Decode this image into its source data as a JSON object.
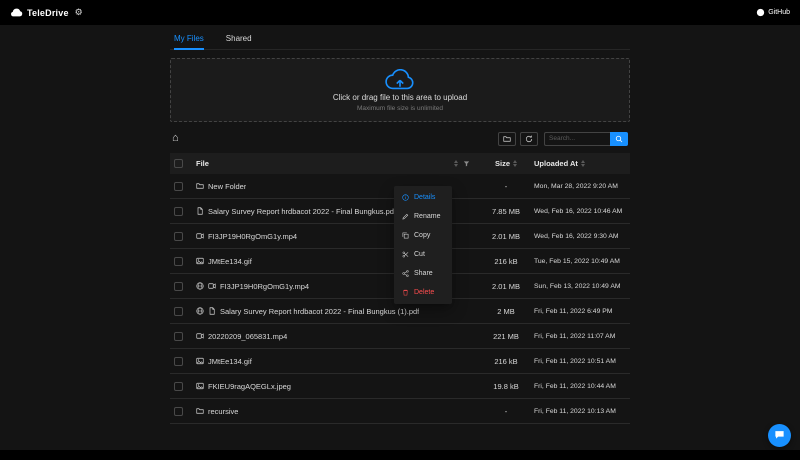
{
  "header": {
    "app_name": "TeleDrive",
    "logo_icon": "cloud-icon",
    "settings_icon": "gear-icon",
    "github_icon": "github-icon",
    "github_label": "GitHub"
  },
  "tabs": [
    {
      "label": "My Files",
      "active": true
    },
    {
      "label": "Shared",
      "active": false
    }
  ],
  "upload": {
    "icon": "cloud-upload-icon",
    "main_text": "Click or drag file to this area to upload",
    "hint_text": "Maximum file size is unlimited"
  },
  "toolbar": {
    "home_icon": "home-icon",
    "folder_button_icon": "folder-icon",
    "sync_button_icon": "sync-icon",
    "search_placeholder": "Search...",
    "search_button_icon": "search-icon"
  },
  "table": {
    "columns": [
      {
        "label": "File",
        "sortable": true,
        "filterable": true,
        "filter_icon": "filter-icon"
      },
      {
        "label": "Size",
        "sortable": true
      },
      {
        "label": "Uploaded At",
        "sortable": true
      }
    ],
    "rows": [
      {
        "name": "New Folder",
        "icon": "folder-icon",
        "size": "-",
        "uploaded": "Mon, Mar 28, 2022 9:20 AM"
      },
      {
        "name": "Salary Survey Report hrdbacot 2022 - Final Bungkus.pdf",
        "icon": "file-icon",
        "size": "7.85 MB",
        "uploaded": "Wed, Feb 16, 2022 10:46 AM"
      },
      {
        "name": "FI3JP19H0RgOmG1y.mp4",
        "icon": "video-icon",
        "size": "2.01 MB",
        "uploaded": "Wed, Feb 16, 2022 9:30 AM"
      },
      {
        "name": "JMtEe134.gif",
        "icon": "image-icon",
        "size": "216 kB",
        "uploaded": "Tue, Feb 15, 2022 10:49 AM"
      },
      {
        "name": "FI3JP19H0RgOmG1y.mp4",
        "icon": "video-icon",
        "shared": true,
        "size": "2.01 MB",
        "uploaded": "Sun, Feb 13, 2022 10:49 AM"
      },
      {
        "name": "Salary Survey Report hrdbacot 2022 - Final Bungkus (1).pdf",
        "icon": "file-icon",
        "shared": true,
        "size": "2 MB",
        "uploaded": "Fri, Feb 11, 2022 6:49 PM"
      },
      {
        "name": "20220209_065831.mp4",
        "icon": "video-icon",
        "size": "221 MB",
        "uploaded": "Fri, Feb 11, 2022 11:07 AM"
      },
      {
        "name": "JMtEe134.gif",
        "icon": "image-icon",
        "size": "216 kB",
        "uploaded": "Fri, Feb 11, 2022 10:51 AM"
      },
      {
        "name": "FKIEU9ragAQEGLx.jpeg",
        "icon": "image-icon",
        "size": "19.8 kB",
        "uploaded": "Fri, Feb 11, 2022 10:44 AM"
      },
      {
        "name": "recursive",
        "icon": "folder-icon",
        "size": "-",
        "uploaded": "Fri, Feb 11, 2022 10:13 AM"
      }
    ]
  },
  "context_menu": {
    "items": [
      {
        "label": "Details",
        "icon": "info-circle-icon",
        "color": "#1890ff"
      },
      {
        "label": "Rename",
        "icon": "edit-icon"
      },
      {
        "label": "Copy",
        "icon": "copy-icon"
      },
      {
        "label": "Cut",
        "icon": "scissors-icon"
      },
      {
        "label": "Share",
        "icon": "share-icon"
      },
      {
        "label": "Delete",
        "icon": "trash-icon",
        "color": "#ff4d4f"
      }
    ]
  },
  "fab": {
    "icon": "chat-icon"
  },
  "colors": {
    "accent": "#1890ff",
    "danger": "#ff4d4f",
    "background": "#141414",
    "header": "#000000"
  }
}
